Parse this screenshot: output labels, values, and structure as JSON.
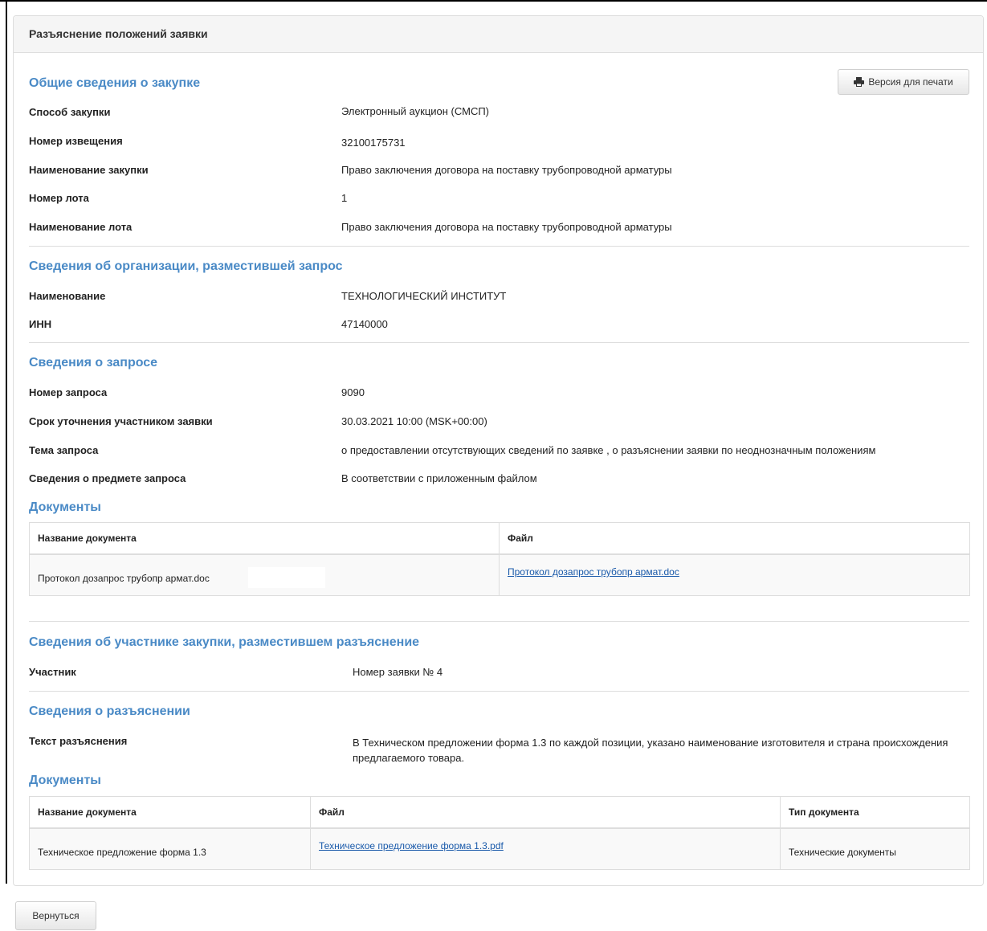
{
  "panel": {
    "title": "Разъяснение положений заявки"
  },
  "print_button": {
    "label": "Версия для печати",
    "icon": "printer-icon"
  },
  "procurement": {
    "heading": "Общие сведения о закупке",
    "method_label": "Способ закупки",
    "method_value": "Электронный аукцион (СМСП)",
    "notice_label": "Номер извещения",
    "notice_value": "32100175731",
    "name_label": "Наименование закупки",
    "name_value": "Право заключения договора на поставку трубопроводной арматуры",
    "lot_no_label": "Номер лота",
    "lot_no_value": "1",
    "lot_name_label": "Наименование лота",
    "lot_name_value": "Право заключения договора на поставку трубопроводной арматуры"
  },
  "organization": {
    "heading": "Сведения об организации, разместившей запрос",
    "name_label": "Наименование",
    "name_value": "ТЕХНОЛОГИЧЕСКИЙ ИНСТИТУТ",
    "inn_label": "ИНН",
    "inn_value": "47140000"
  },
  "request": {
    "heading": "Сведения о запросе",
    "number_label": "Номер запроса",
    "number_value": "9090",
    "deadline_label": "Срок уточнения участником заявки",
    "deadline_value": "30.03.2021 10:00 (MSK+00:00)",
    "topic_label": "Тема запроса",
    "topic_value": "о предоставлении отсутствующих сведений по заявке , о разъяснении заявки по неоднозначным положениям",
    "subject_label": "Сведения о предмете запроса",
    "subject_value": "В соответствии с приложенным файлом",
    "docs_heading": "Документы",
    "docs_columns": [
      "Название документа",
      "Файл"
    ],
    "docs_rows": [
      {
        "name": "Протокол дозапрос трубопр армат.doc",
        "file": "Протокол дозапрос трубопр армат.doc"
      }
    ]
  },
  "participant": {
    "heading": "Сведения об участнике закупки, разместившем разъяснение",
    "label": "Участник",
    "value": "Номер заявки № 4"
  },
  "clarification": {
    "heading": "Сведения о разъяснении",
    "text_label": "Текст разъяснения",
    "text_value": "В Техническом предложении форма 1.3 по каждой позиции, указано наименование изготовителя и страна происхождения предлагаемого товара.",
    "docs_heading": "Документы",
    "docs_columns": [
      "Название документа",
      "Файл",
      "Тип документа"
    ],
    "docs_rows": [
      {
        "name": "Техническое предложение форма 1.3",
        "file": "Техническое предложение форма 1.3.pdf",
        "type": "Технические документы"
      }
    ]
  },
  "back_button": {
    "label": "Вернуться"
  },
  "colors": {
    "heading": "#4a8ac6",
    "link": "#1a5aaa",
    "border": "#dddddd",
    "panel_head": "#f5f5f5"
  }
}
